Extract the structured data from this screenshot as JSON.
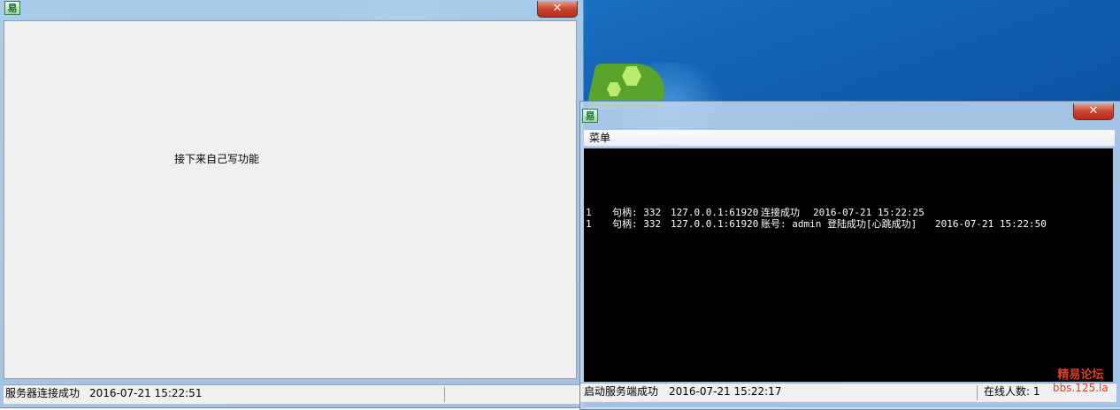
{
  "client_window": {
    "icon_glyph": "易",
    "close_glyph": "✕",
    "main_label": "接下来自己写功能",
    "status": {
      "message": "服务器连接成功",
      "timestamp": "2016-07-21 15:22:51"
    }
  },
  "server_window": {
    "icon_glyph": "易",
    "close_glyph": "✕",
    "menu": {
      "items": [
        "菜单"
      ]
    },
    "log": {
      "rows": [
        {
          "index": "1",
          "handle": "句柄: 332",
          "address": "127.0.0.1:61920",
          "event": "连接成功",
          "time": "2016-07-21 15:22:25"
        },
        {
          "index": "1",
          "handle": "句柄: 332",
          "address": "127.0.0.1:61920",
          "event": "账号: admin  登陆成功[心跳成功]",
          "time": "2016-07-21 15:22:50"
        }
      ]
    },
    "status": {
      "message": "启动服务端成功",
      "timestamp": "2016-07-21 15:22:17",
      "online": "在线人数: 1"
    }
  },
  "watermark": {
    "line1": "精易论坛",
    "line2": "bbs.125.la"
  },
  "colors": {
    "desktop": "#1566b8",
    "window_bg": "#f0f0f0",
    "console_bg": "#000000",
    "close_red": "#c7422c",
    "watermark": "#d9402b"
  }
}
